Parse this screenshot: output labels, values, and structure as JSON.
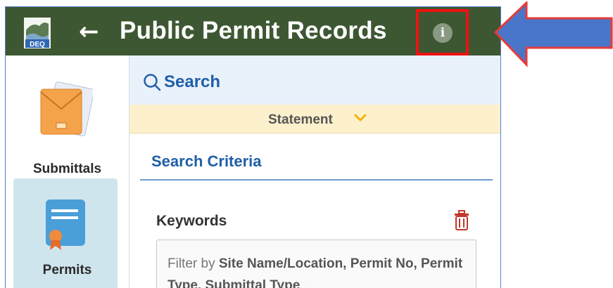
{
  "header": {
    "logo_text": "DEQ",
    "back_icon": "←",
    "title": "Public Permit Records",
    "info_icon": "i"
  },
  "sidebar": {
    "items": [
      {
        "label": "Submittals",
        "icon": "envelope-icon",
        "active": false
      },
      {
        "label": "Permits",
        "icon": "certificate-icon",
        "active": true
      }
    ]
  },
  "main": {
    "search_label": "Search",
    "statement_label": "Statement",
    "criteria_title": "Search Criteria",
    "keywords_label": "Keywords",
    "keywords_placeholder_parts": [
      "Filter by ",
      "Site Name/Location, Permit No, Permit Type, Submittal Type",
      "..."
    ]
  },
  "colors": {
    "header_bg": "#3d5732",
    "accent_blue": "#1f5fa8",
    "highlight_red": "#ee1111",
    "arrow_blue": "#4a76c9"
  }
}
